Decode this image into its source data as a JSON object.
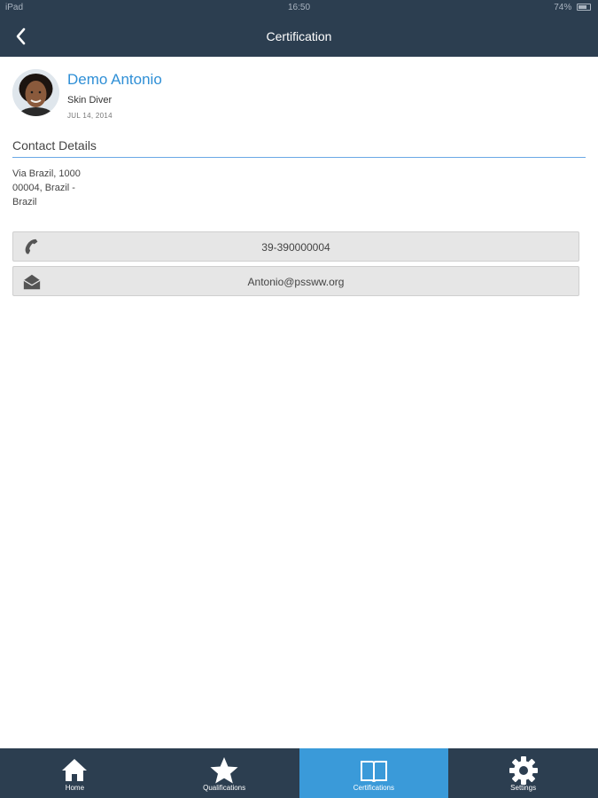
{
  "status_bar": {
    "device": "iPad",
    "time": "16:50",
    "battery": "74%"
  },
  "nav": {
    "title": "Certification",
    "back_icon": "chevron-left-icon"
  },
  "profile": {
    "name": "Demo Antonio",
    "role": "Skin Diver",
    "date": "JUL 14, 2014"
  },
  "contact": {
    "section_title": "Contact Details",
    "address_lines": [
      "Via Brazil, 1000",
      "00004, Brazil -",
      "Brazil"
    ],
    "phone": "39-390000004",
    "phone_icon": "phone-icon",
    "email": "Antonio@pssww.org",
    "email_icon": "envelope-icon"
  },
  "tabs": [
    {
      "label": "Home",
      "icon": "home-icon",
      "active": false
    },
    {
      "label": "Qualifications",
      "icon": "star-icon",
      "active": false
    },
    {
      "label": "Certifications",
      "icon": "book-icon",
      "active": true
    },
    {
      "label": "Settings",
      "icon": "gear-icon",
      "active": false
    }
  ],
  "colors": {
    "bar_bg": "#2c3e50",
    "accent": "#3a9ad9",
    "name_blue": "#2f8fd6"
  }
}
